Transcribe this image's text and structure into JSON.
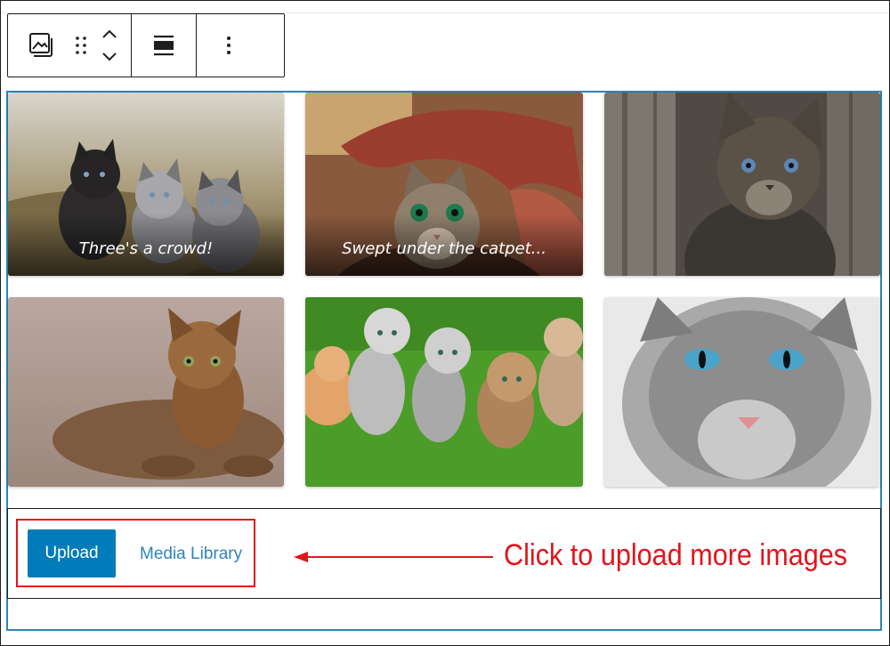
{
  "toolbar": {
    "buttons": [
      {
        "name": "gallery-block-icon"
      },
      {
        "name": "drag-handle-icon"
      },
      {
        "name": "move-up-icon"
      },
      {
        "name": "move-down-icon"
      },
      {
        "name": "align-icon"
      },
      {
        "name": "more-options-icon"
      }
    ]
  },
  "gallery": {
    "images": [
      {
        "subject": "three kittens in straw",
        "caption": "Three's a crowd!"
      },
      {
        "subject": "kitten under blanket",
        "caption": "Swept under the catpet..."
      },
      {
        "subject": "tabby kitten by wood",
        "caption": ""
      },
      {
        "subject": "tabby cat lying on ground",
        "caption": ""
      },
      {
        "subject": "five kittens on grass",
        "caption": ""
      },
      {
        "subject": "grey cat with blue eyes",
        "caption": ""
      }
    ]
  },
  "upload": {
    "upload_label": "Upload",
    "media_library_label": "Media Library"
  },
  "annotation": {
    "text": "Click to upload more images",
    "color": "#e0161b"
  },
  "colors": {
    "accent": "#007cba",
    "selection_border": "#2e84b7"
  }
}
